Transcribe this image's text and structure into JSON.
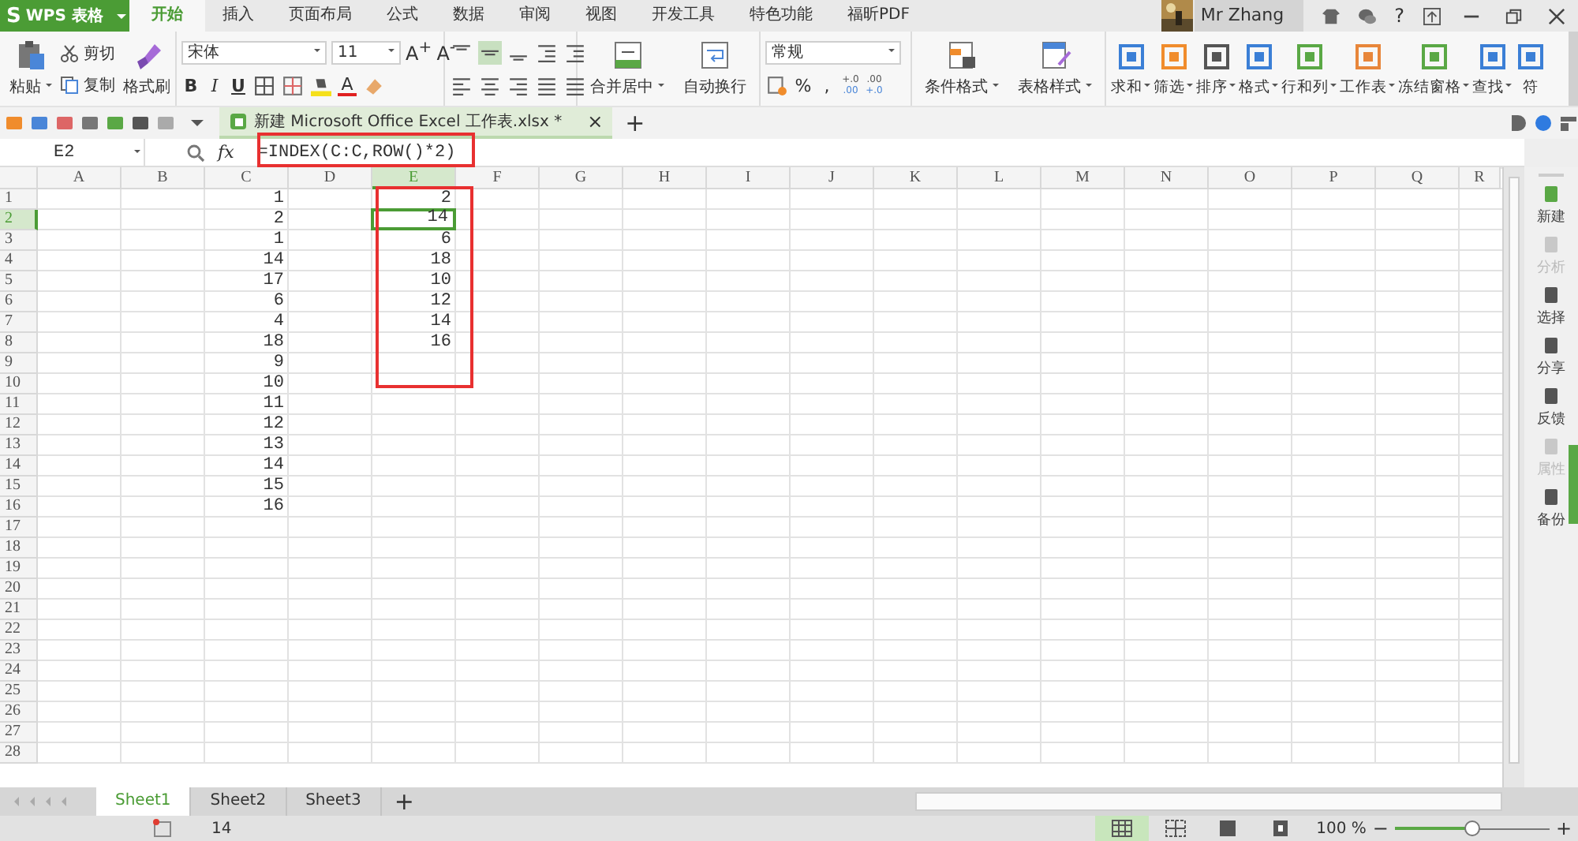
{
  "app": {
    "logo": "S",
    "name": "WPS 表格"
  },
  "menu_tabs": [
    {
      "label": "开始",
      "selected": true
    },
    {
      "label": "插入",
      "selected": false
    },
    {
      "label": "页面布局",
      "selected": false
    },
    {
      "label": "公式",
      "selected": false
    },
    {
      "label": "数据",
      "selected": false
    },
    {
      "label": "审阅",
      "selected": false
    },
    {
      "label": "视图",
      "selected": false
    },
    {
      "label": "开发工具",
      "selected": false
    },
    {
      "label": "特色功能",
      "selected": false
    },
    {
      "label": "福昕PDF",
      "selected": false
    }
  ],
  "user": {
    "name": "Mr Zhang",
    "help": "?"
  },
  "ribbon": {
    "paste": "粘贴",
    "cut": "剪切",
    "copy": "复制",
    "format_painter": "格式刷",
    "font_name": "宋体",
    "font_size": "11",
    "grow_font": "A$^{+}$",
    "shrink_font": "A$^{-}$",
    "style_buttons": [
      "B",
      "I",
      "U"
    ],
    "font_color": "A",
    "number_format": "常规",
    "percent": "%",
    "comma": ",",
    "decimals": [
      {
        "top": "+.0",
        "bottom": ".00"
      },
      {
        "top": ".00",
        "bottom": "+.0"
      }
    ],
    "align_buttons": [
      {
        "label": "合并居中",
        "dropdown": true
      },
      {
        "label": "自动换行",
        "dropdown": false
      }
    ],
    "style_buttons_big": [
      {
        "label": "条件格式",
        "dropdown": true
      },
      {
        "label": "表格样式",
        "dropdown": true
      }
    ],
    "tool_buttons": [
      {
        "label": "求和",
        "dropdown": true
      },
      {
        "label": "筛选",
        "dropdown": true
      },
      {
        "label": "排序",
        "dropdown": true
      },
      {
        "label": "格式",
        "dropdown": true
      },
      {
        "label": "行和列",
        "dropdown": true
      },
      {
        "label": "工作表",
        "dropdown": true
      },
      {
        "label": "冻结窗格",
        "dropdown": true
      },
      {
        "label": "查找",
        "dropdown": true
      },
      {
        "label": "符",
        "dropdown": false
      }
    ]
  },
  "doc_tab": {
    "title": "新建 Microsoft Office Excel 工作表.xlsx *",
    "close": "×",
    "new_tab": "+"
  },
  "formula_bar": {
    "name_box": "E2",
    "fx": "fx",
    "formula": "=INDEX(C:C,ROW()*2)"
  },
  "sheet": {
    "columns": [
      {
        "label": "A",
        "selected": false
      },
      {
        "label": "B",
        "selected": false
      },
      {
        "label": "C",
        "selected": false
      },
      {
        "label": "D",
        "selected": false
      },
      {
        "label": "E",
        "selected": true
      },
      {
        "label": "F",
        "selected": false
      },
      {
        "label": "G",
        "selected": false
      },
      {
        "label": "H",
        "selected": false
      },
      {
        "label": "I",
        "selected": false
      },
      {
        "label": "J",
        "selected": false
      },
      {
        "label": "K",
        "selected": false
      },
      {
        "label": "L",
        "selected": false
      },
      {
        "label": "M",
        "selected": false
      },
      {
        "label": "N",
        "selected": false
      },
      {
        "label": "O",
        "selected": false
      },
      {
        "label": "P",
        "selected": false
      },
      {
        "label": "Q",
        "selected": false
      },
      {
        "label": "R",
        "selected": false
      }
    ],
    "rows": [
      {
        "label": "1",
        "selected": false,
        "column_c": "1",
        "column_e": "2"
      },
      {
        "label": "2",
        "selected": true,
        "column_c": "2",
        "column_e": "14"
      },
      {
        "label": "3",
        "selected": false,
        "column_c": "1",
        "column_e": "6"
      },
      {
        "label": "4",
        "selected": false,
        "column_c": "14",
        "column_e": "18"
      },
      {
        "label": "5",
        "selected": false,
        "column_c": "17",
        "column_e": "10"
      },
      {
        "label": "6",
        "selected": false,
        "column_c": "6",
        "column_e": "12"
      },
      {
        "label": "7",
        "selected": false,
        "column_c": "4",
        "column_e": "14"
      },
      {
        "label": "8",
        "selected": false,
        "column_c": "18",
        "column_e": "16"
      },
      {
        "label": "9",
        "selected": false,
        "column_c": "9"
      },
      {
        "label": "10",
        "selected": false,
        "column_c": "10"
      },
      {
        "label": "11",
        "selected": false,
        "column_c": "11"
      },
      {
        "label": "12",
        "selected": false,
        "column_c": "12"
      },
      {
        "label": "13",
        "selected": false,
        "column_c": "13"
      },
      {
        "label": "14",
        "selected": false,
        "column_c": "14"
      },
      {
        "label": "15",
        "selected": false,
        "column_c": "15"
      },
      {
        "label": "16",
        "selected": false,
        "column_c": "16"
      },
      {
        "label": "17",
        "selected": false
      },
      {
        "label": "18",
        "selected": false
      },
      {
        "label": "19",
        "selected": false
      },
      {
        "label": "20",
        "selected": false
      },
      {
        "label": "21",
        "selected": false
      },
      {
        "label": "22",
        "selected": false
      },
      {
        "label": "23",
        "selected": false
      },
      {
        "label": "24",
        "selected": false
      },
      {
        "label": "25",
        "selected": false
      },
      {
        "label": "26",
        "selected": false
      },
      {
        "label": "27",
        "selected": false
      },
      {
        "label": "28",
        "selected": false
      }
    ]
  },
  "sheet_tabs": [
    {
      "label": "Sheet1",
      "selected": true
    },
    {
      "label": "Sheet2",
      "selected": false
    },
    {
      "label": "Sheet3",
      "selected": false
    }
  ],
  "add_sheet": "+",
  "sidebar": [
    {
      "label": "新建",
      "disabled": false
    },
    {
      "label": "分析",
      "disabled": true
    },
    {
      "label": "选择",
      "disabled": false
    },
    {
      "label": "分享",
      "disabled": false
    },
    {
      "label": "反馈",
      "disabled": false
    },
    {
      "label": "属性",
      "disabled": true
    },
    {
      "label": "备份",
      "disabled": false
    }
  ],
  "status_bar": {
    "value": "14",
    "zoom": "100 %",
    "zoom_out": "−",
    "zoom_in": "+",
    "zoom_slider": {
      "level": 0.5
    }
  }
}
